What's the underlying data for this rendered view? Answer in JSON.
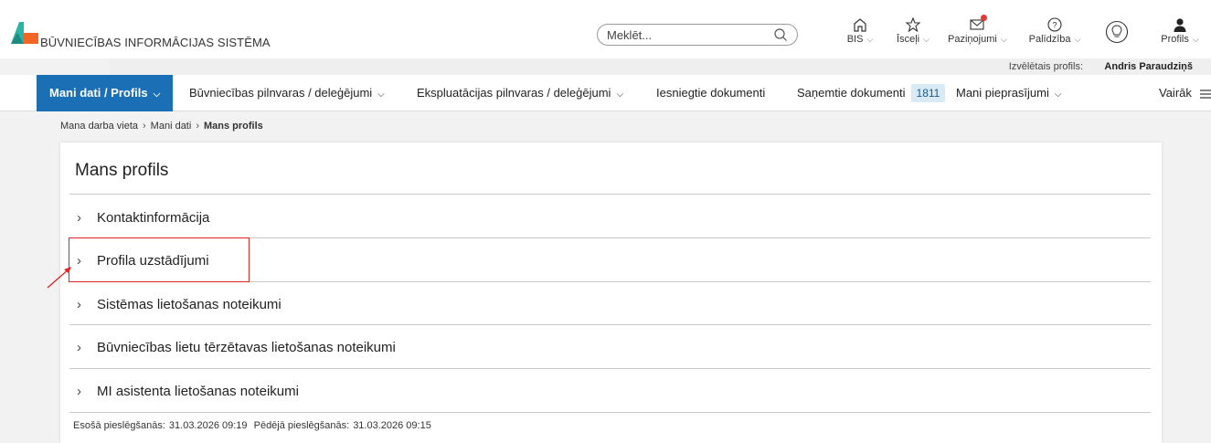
{
  "header": {
    "app_title": "BŪVNIECĪBAS INFORMĀCIJAS SISTĒMA",
    "search": {
      "placeholder": "Meklēt..."
    },
    "nav": [
      {
        "label": "BIS",
        "icon": "home-icon",
        "dropdown": true
      },
      {
        "label": "Īsceļi",
        "icon": "star-icon",
        "dropdown": true
      },
      {
        "label": "Paziņojumi",
        "icon": "envelope-icon",
        "dropdown": true,
        "has_unread": true
      },
      {
        "label": "Palīdzība",
        "icon": "help-icon",
        "dropdown": true
      },
      {
        "label": "",
        "icon": "lightbulb-icon",
        "dropdown": false
      },
      {
        "label": "Profils",
        "icon": "user-icon",
        "dropdown": true
      }
    ]
  },
  "selected_profile": {
    "label": "Izvēlētais profils:",
    "name": "Andris Paraudziņš"
  },
  "main_nav": {
    "items": [
      {
        "label": "Mani dati / Profils",
        "active": true,
        "dropdown": true
      },
      {
        "label": "Būvniecības pilnvaras / deleģējumi",
        "dropdown": true
      },
      {
        "label": "Ekspluatācijas pilnvaras / deleģējumi",
        "dropdown": true
      },
      {
        "label": "Iesniegtie dokumenti"
      },
      {
        "label": "Saņemtie dokumenti",
        "badge": "1811"
      },
      {
        "label": "Mani pieprasījumi",
        "dropdown": true
      }
    ],
    "more_label": "Vairāk"
  },
  "breadcrumb": [
    "Mana darba vieta",
    "Mani dati",
    "Mans profils"
  ],
  "page": {
    "title": "Mans profils",
    "sections": [
      "Kontaktinformācija",
      "Profila uzstādījumi",
      "Sistēmas lietošanas noteikumi",
      "Būvniecības lietu tērzētavas lietošanas noteikumi",
      "MI asistenta lietošanas noteikumi"
    ],
    "session": {
      "current_label": "Esošā pieslēgšanās:",
      "current_value": "31.03.2026 09:19",
      "last_label": "Pēdējā pieslēgšanās:",
      "last_value": "31.03.2026 09:15"
    }
  },
  "colors": {
    "primary": "#1a6fb5",
    "highlight": "#e02424",
    "logo_teal": "#2bb3a3",
    "logo_orange": "#f26522"
  }
}
